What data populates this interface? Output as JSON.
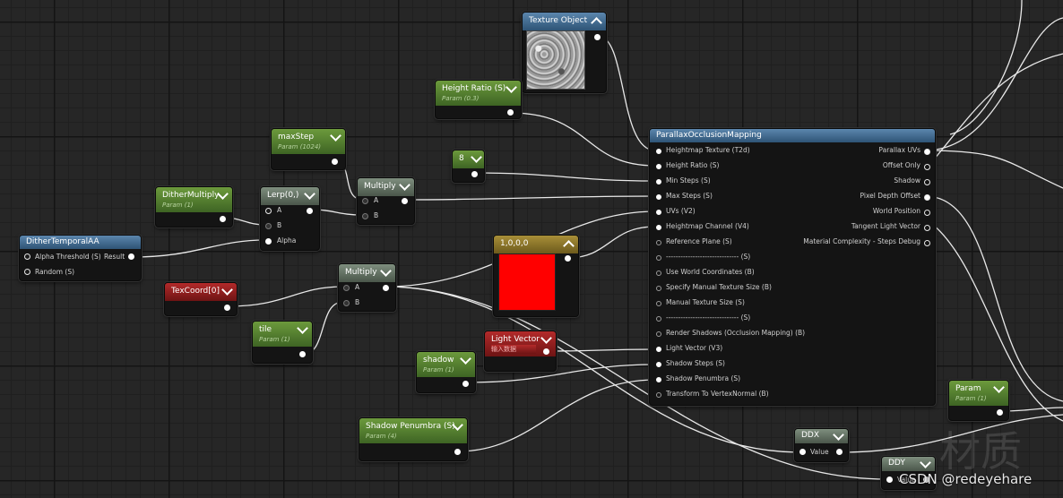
{
  "nodes": {
    "texture_object": {
      "title": "Texture Object"
    },
    "height_ratio": {
      "title": "Height Ratio (S)",
      "sub": "Param (0.3)"
    },
    "max_step": {
      "title": "maxStep",
      "sub": "Param (1024)"
    },
    "const_8": {
      "title": "8"
    },
    "multiply_top": {
      "title": "Multiply",
      "a": "A",
      "b": "B"
    },
    "lerp": {
      "title": "Lerp(0,)",
      "a": "A",
      "b": "B",
      "alpha": "Alpha"
    },
    "dither_multiply": {
      "title": "DitherMultiply",
      "sub": "Param (1)"
    },
    "dither_temporal": {
      "title": "DitherTemporalAA",
      "in1": "Alpha Threshold (S)",
      "in2": "Random (S)",
      "out": "Result"
    },
    "const4": {
      "title": "1,0,0,0"
    },
    "texcoord": {
      "title": "TexCoord[0]"
    },
    "multiply_bottom": {
      "title": "Multiply",
      "a": "A",
      "b": "B"
    },
    "tile": {
      "title": "tile",
      "sub": "Param (1)"
    },
    "light_vector": {
      "title": "Light Vector",
      "sub": "输入数据"
    },
    "shadow": {
      "title": "shadow",
      "sub": "Param (1)"
    },
    "shadow_penumbra": {
      "title": "Shadow Penumbra (S)",
      "sub": "Param (4)"
    },
    "param": {
      "title": "Param",
      "sub": "Param (1)"
    },
    "ddx": {
      "title": "DDX",
      "out": "Value"
    },
    "ddy": {
      "title": "DDY",
      "out": "Value"
    },
    "pom": {
      "title": "ParallaxOcclusionMapping",
      "inputs": [
        "Heightmap Texture (T2d)",
        "Height Ratio (S)",
        "Min Steps (S)",
        "Max Steps (S)",
        "UVs (V2)",
        "Heightmap Channel (V4)",
        "Reference Plane (S)",
        "------------------------------ (S)",
        "Use World Coordinates (B)",
        "Specify Manual Texture Size (B)",
        "Manual Texture Size (S)",
        "------------------------------ (S)",
        "Render Shadows (Occlusion Mapping) (B)",
        "Light Vector (V3)",
        "Shadow Steps (S)",
        "Shadow Penumbra (S)",
        "Transform To VertexNormal (B)"
      ],
      "outputs": [
        "Parallax UVs",
        "Offset Only",
        "Shadow",
        "Pixel Depth Offset",
        "World Position",
        "Tangent Light Vector",
        "Material Complexity - Steps Debug"
      ]
    }
  },
  "watermark": {
    "cn": "材质",
    "csdn": "CSDN @redeyehare"
  }
}
